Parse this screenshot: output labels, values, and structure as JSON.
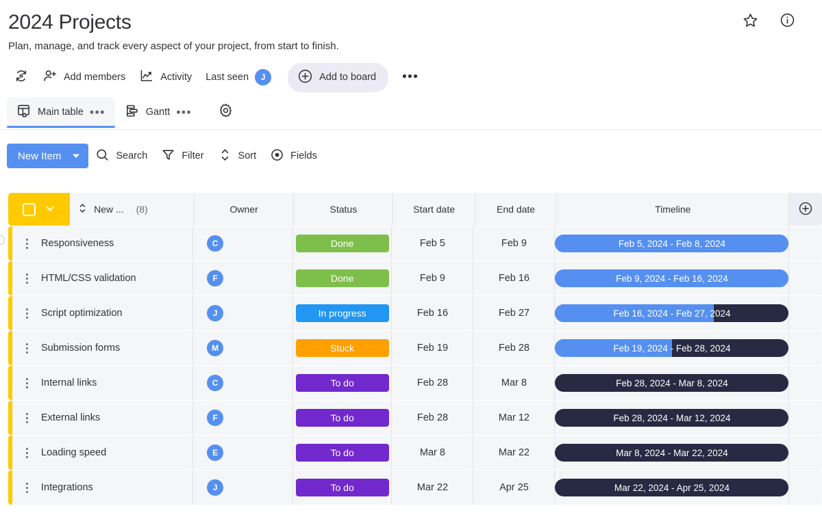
{
  "header": {
    "title": "2024 Projects",
    "subtitle": "Plan, manage, and track every aspect of your project, from start to finish.",
    "star_label": "star-icon",
    "info_label": "info-icon"
  },
  "topbar": {
    "sync_label": "sync-icon",
    "add_members": "Add members",
    "activity": "Activity",
    "last_seen": "Last seen",
    "last_seen_avatar": "J",
    "add_to_board": "Add to board",
    "more_label": "•••"
  },
  "tabs": {
    "items": [
      {
        "label": "Main table",
        "more": "•••",
        "active": true
      },
      {
        "label": "Gantt",
        "more": "•••",
        "active": false
      }
    ],
    "settings_label": "gear-icon"
  },
  "filterbar": {
    "new_item": "New Item",
    "search": "Search",
    "filter": "Filter",
    "sort": "Sort",
    "fields": "Fields"
  },
  "table": {
    "columns": {
      "name": "New ...",
      "name_count": "(8)",
      "owner": "Owner",
      "status": "Status",
      "start": "Start date",
      "end": "End date",
      "timeline": "Timeline",
      "add_column": "add-column-icon"
    },
    "colors": {
      "accent_yellow": "#ffcb00",
      "brand_blue": "#5590f0",
      "done_green": "#7ebf4c",
      "in_progress_blue": "#2196f3",
      "stuck_orange": "#ffa000",
      "todo_purple": "#7129cd",
      "timeline_dark": "#272a42",
      "row_bg": "#f5f6f8"
    },
    "rows": [
      {
        "name": "Responsiveness",
        "owner": "C",
        "status": "Done",
        "status_color": "#7ebf4c",
        "start": "Feb 5",
        "end": "Feb 9",
        "timeline": "Feb 5, 2024 - Feb 8, 2024",
        "bar_color": "#5590f0",
        "fill_pct": 100
      },
      {
        "name": "HTML/CSS validation",
        "owner": "F",
        "status": "Done",
        "status_color": "#7ebf4c",
        "start": "Feb 9",
        "end": "Feb 16",
        "timeline": "Feb 9, 2024 - Feb 16, 2024",
        "bar_color": "#5590f0",
        "fill_pct": 100
      },
      {
        "name": "Script optimization",
        "owner": "J",
        "status": "In progress",
        "status_color": "#2196f3",
        "start": "Feb 16",
        "end": "Feb 27",
        "timeline": "Feb 16, 2024 - Feb 27, 2024",
        "bar_color": "#272a42",
        "fill_pct": 68
      },
      {
        "name": "Submission forms",
        "owner": "M",
        "status": "Stuck",
        "status_color": "#ffa000",
        "start": "Feb 19",
        "end": "Feb 28",
        "timeline": "Feb 19, 2024 - Feb 28, 2024",
        "bar_color": "#272a42",
        "fill_pct": 50
      },
      {
        "name": "Internal links",
        "owner": "C",
        "status": "To do",
        "status_color": "#7129cd",
        "start": "Feb 28",
        "end": "Mar 8",
        "timeline": "Feb 28, 2024 - Mar 8, 2024",
        "bar_color": "#272a42",
        "fill_pct": 0
      },
      {
        "name": "External links",
        "owner": "F",
        "status": "To do",
        "status_color": "#7129cd",
        "start": "Feb 28",
        "end": "Mar 12",
        "timeline": "Feb 28, 2024 - Mar 12, 2024",
        "bar_color": "#272a42",
        "fill_pct": 0
      },
      {
        "name": "Loading speed",
        "owner": "E",
        "status": "To do",
        "status_color": "#7129cd",
        "start": "Mar 8",
        "end": "Mar 22",
        "timeline": "Mar 8, 2024 - Mar 22, 2024",
        "bar_color": "#272a42",
        "fill_pct": 0
      },
      {
        "name": "Integrations",
        "owner": "J",
        "status": "To do",
        "status_color": "#7129cd",
        "start": "Mar 22",
        "end": "Apr 25",
        "timeline": "Mar 22, 2024 - Apr 25, 2024",
        "bar_color": "#272a42",
        "fill_pct": 0
      }
    ]
  }
}
